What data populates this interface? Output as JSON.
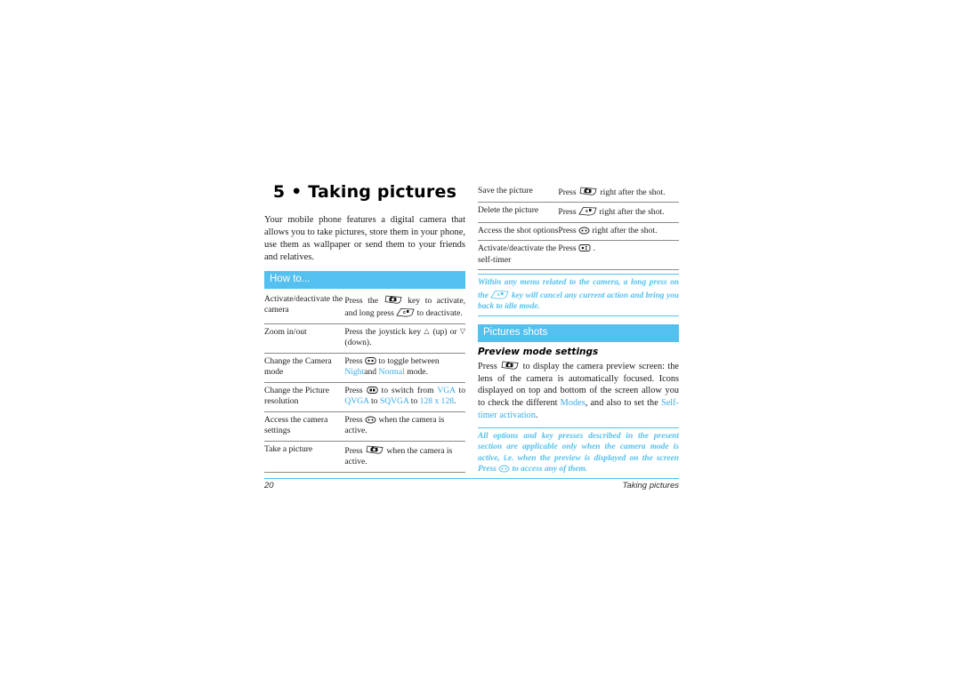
{
  "chapter": {
    "title": "5 • Taking pictures",
    "intro": "Your mobile phone features a digital camera that allows you to take pictures, store them in your phone, use them as wallpaper or send them to your friends and relatives."
  },
  "sections": {
    "how_to": "How to...",
    "pictures_shots": "Pictures shots"
  },
  "how_to_table": {
    "rows": [
      {
        "action": "Activate/deactivate the camera",
        "instruction_parts": [
          {
            "type": "text",
            "value": "Press the "
          },
          {
            "type": "icon",
            "value": "camera-key-icon"
          },
          {
            "type": "text",
            "value": " key to activate, and long press "
          },
          {
            "type": "icon",
            "value": "clear-key-icon"
          },
          {
            "type": "text",
            "value": " to deactivate."
          }
        ],
        "text_a": "Press the",
        "text_b": "key to activate, and long press",
        "text_c": "to deactivate."
      },
      {
        "action": "Zoom in/out",
        "text_a": "Press the joystick key",
        "text_b": "(up) or",
        "text_c": "(down)."
      },
      {
        "action": "Change the Camera mode",
        "text_a": "Press",
        "text_b": "to toggle between",
        "link_1": "Night",
        "text_c": "and",
        "link_2": "Normal",
        "text_d": "mode."
      },
      {
        "action": "Change the Picture resolution",
        "text_a": "Press",
        "text_b": "to switch from",
        "link_1": "VGA",
        "text_c": "to",
        "link_2": "QVGA",
        "text_d": "to",
        "link_3": "SQVGA",
        "text_e": "to",
        "link_4": "128 x 128",
        "text_f": "."
      },
      {
        "action": "Access the camera settings",
        "text_a": "Press",
        "text_b": "when the camera is active."
      },
      {
        "action": "Take a picture",
        "text_a": "Press",
        "text_b": "when the camera is active."
      }
    ]
  },
  "shots_table": {
    "rows": [
      {
        "action": "Save the picture",
        "text_a": "Press",
        "text_b": "right after the shot."
      },
      {
        "action": "Delete the picture",
        "text_a": "Press",
        "text_b": "right after the shot."
      },
      {
        "action": "Access the shot options",
        "text_a": "Press",
        "text_b": "right after the shot."
      },
      {
        "action": "Activate/deactivate the self-timer",
        "text_a": "Press",
        "text_b": "."
      }
    ]
  },
  "notes": {
    "camera_menu": {
      "part_a": "Within any menu related to the camera, a long press on the",
      "part_b": "key will cancel any current action and bring you back to idle mode."
    },
    "options_active": {
      "part_a": "All options and key presses described in the present section are applicable only when the camera mode is active, i.e. when the preview is displayed on the screen Press",
      "part_b": "to access any of them."
    }
  },
  "preview": {
    "subhead": "Preview mode settings",
    "text_a": "Press",
    "text_b": "to display the camera preview screen: the lens of the camera is automatically focused. Icons displayed on top and bottom of the screen allow you to check the different",
    "link_1": "Modes",
    "text_c": ", and also to set the",
    "link_2": "Self-timer activation",
    "text_d": "."
  },
  "footer": {
    "page_number": "20",
    "chapter_name": "Taking pictures"
  },
  "glyphs": {
    "up_arrow": "△",
    "down_arrow": "▽"
  },
  "colors": {
    "accent_blue": "#53c0ef",
    "link_blue": "#3aabe8",
    "rule_gray": "#8a8a8a"
  }
}
